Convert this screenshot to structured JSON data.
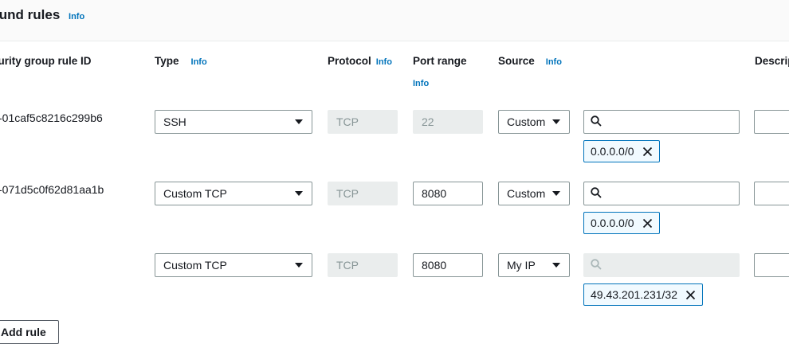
{
  "section": {
    "title": "bound rules",
    "info": "Info"
  },
  "columns": {
    "rule_id": "curity group rule ID",
    "type": "Type",
    "type_info": "Info",
    "protocol": "Protocol",
    "protocol_info": "Info",
    "port_range": "Port range",
    "port_range_info": "Info",
    "source": "Source",
    "source_info": "Info",
    "description": "Descrip"
  },
  "rules": [
    {
      "id": "-01caf5c8216c299b6",
      "type": "SSH",
      "protocol": "TCP",
      "port": "22",
      "port_editable": false,
      "source": "Custom",
      "cidr": "0.0.0.0/0",
      "search_disabled": false
    },
    {
      "id": "-071d5c0f62d81aa1b",
      "type": "Custom TCP",
      "protocol": "TCP",
      "port": "8080",
      "port_editable": true,
      "source": "Custom",
      "cidr": "0.0.0.0/0",
      "search_disabled": false
    },
    {
      "id": "",
      "type": "Custom TCP",
      "protocol": "TCP",
      "port": "8080",
      "port_editable": true,
      "source": "My IP",
      "cidr": "49.43.201.231/32",
      "search_disabled": true
    }
  ],
  "add_rule_label": "Add rule",
  "icons": {
    "caret": "caret-down-icon",
    "search": "search-icon",
    "remove": "close-icon"
  },
  "colors": {
    "link": "#0073bb",
    "token_border": "#0073bb",
    "token_bg": "#f1faff",
    "disabled_bg": "#eaeded",
    "text": "#16191f"
  }
}
